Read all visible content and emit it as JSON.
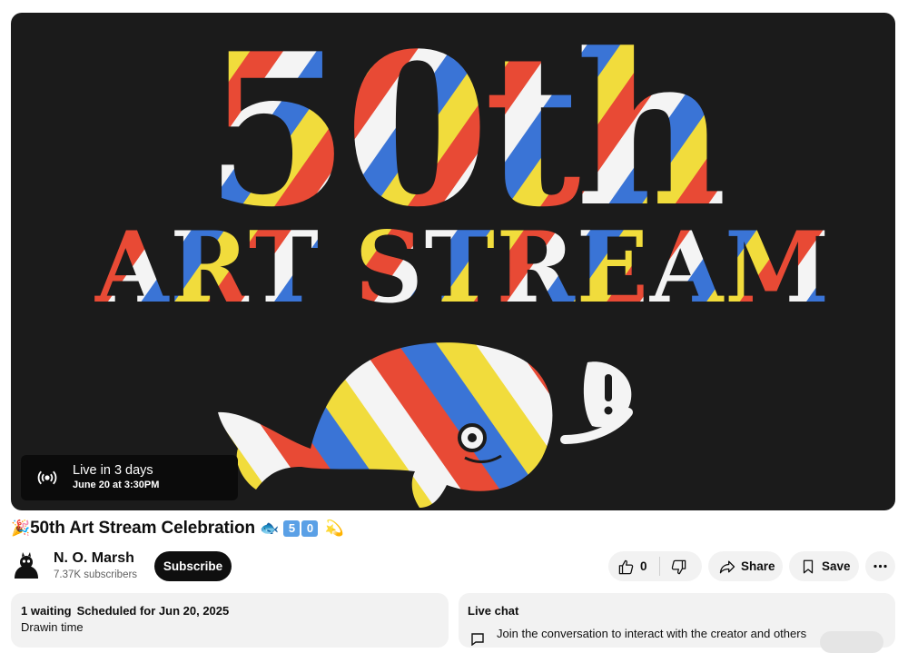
{
  "video": {
    "live_status": "Live in 3 days",
    "live_datetime": "June 20 at 3:30PM",
    "thumbnail_text_line1": "50th",
    "thumbnail_text_line2": "ART STREAM"
  },
  "title": {
    "prefix_emoji": "🎉",
    "text": "50th Art Stream Celebration",
    "suffix_emoji_1": "🐟",
    "keycap_1": "5",
    "keycap_2": "0",
    "suffix_emoji_2": "💫"
  },
  "channel": {
    "name": "N. O. Marsh",
    "subscribers": "7.37K subscribers",
    "subscribe_label": "Subscribe"
  },
  "actions": {
    "like_count": "0",
    "share_label": "Share",
    "save_label": "Save"
  },
  "description": {
    "waiting": "1 waiting",
    "scheduled": "Scheduled for Jun 20, 2025",
    "body": "Drawin time"
  },
  "live_chat": {
    "header": "Live chat",
    "prompt": "Join the conversation to interact with the creator and others"
  },
  "colors": {
    "red": "#e84a35",
    "blue": "#3a74d6",
    "yellow": "#f1dc3c",
    "white": "#f4f4f4",
    "player_bg": "#1b1b1b"
  }
}
